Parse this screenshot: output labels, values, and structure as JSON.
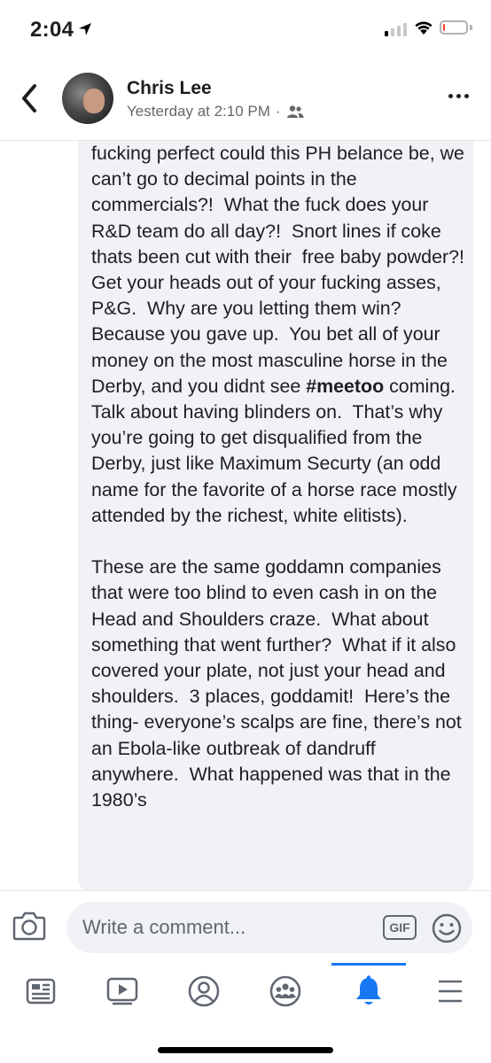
{
  "status_bar": {
    "time": "2:04",
    "icons": [
      "location-arrow-icon",
      "cellular-signal-icon",
      "wifi-icon",
      "battery-low-icon"
    ],
    "signal_bars_active": 1,
    "battery_level": 0.1,
    "battery_color": "#ff3b30"
  },
  "header": {
    "author": "Chris Lee",
    "timestamp": "Yesterday at 2:10 PM",
    "separator": "·",
    "privacy_icon": "friends-icon",
    "back_icon": "chevron-left-icon",
    "more_icon": "more-horizontal-icon"
  },
  "post": {
    "p1_a": "fucking perfect could this PH belance be, we can’t go to decimal points in the commercials?!  What the fuck does your R&D team do all day?!  Snort lines if coke thats been cut with their  free baby powder?!  Get your heads out of your fucking asses, P&G.  Why are you letting them win?  Because you gave up.  You bet all of your money on the most masculine horse in the Derby, and you didnt see ",
    "hashtag": "#meetoo",
    "p1_b": " coming.  Talk about having blinders on.  That’s why you’re going to get disqualified from the Derby, just like Maximum Securty (an odd name for the favorite of a horse race mostly attended by the richest, white elitists).",
    "p2": "These are the same goddamn companies that were too blind to even cash in on the Head and Shoulders craze.  What about something that went further?  What if it also covered your plate, not just your head and shoulders.  3 places, goddamit!  Here’s the thing- everyone’s scalps are fine, there’s not an Ebola-like outbreak of dandruff anywhere.  What happened was that in the 1980’s"
  },
  "composer": {
    "placeholder": "Write a comment...",
    "gif_label": "GIF",
    "camera_icon": "camera-icon",
    "emoji_icon": "smiley-icon"
  },
  "tabbar": {
    "tabs": [
      {
        "icon": "news-feed-icon",
        "active": false
      },
      {
        "icon": "video-icon",
        "active": false
      },
      {
        "icon": "profile-icon",
        "active": false
      },
      {
        "icon": "groups-icon",
        "active": false
      },
      {
        "icon": "notifications-bell-icon",
        "active": true
      },
      {
        "icon": "menu-icon",
        "active": false
      }
    ],
    "accent_color": "#1877f2"
  }
}
